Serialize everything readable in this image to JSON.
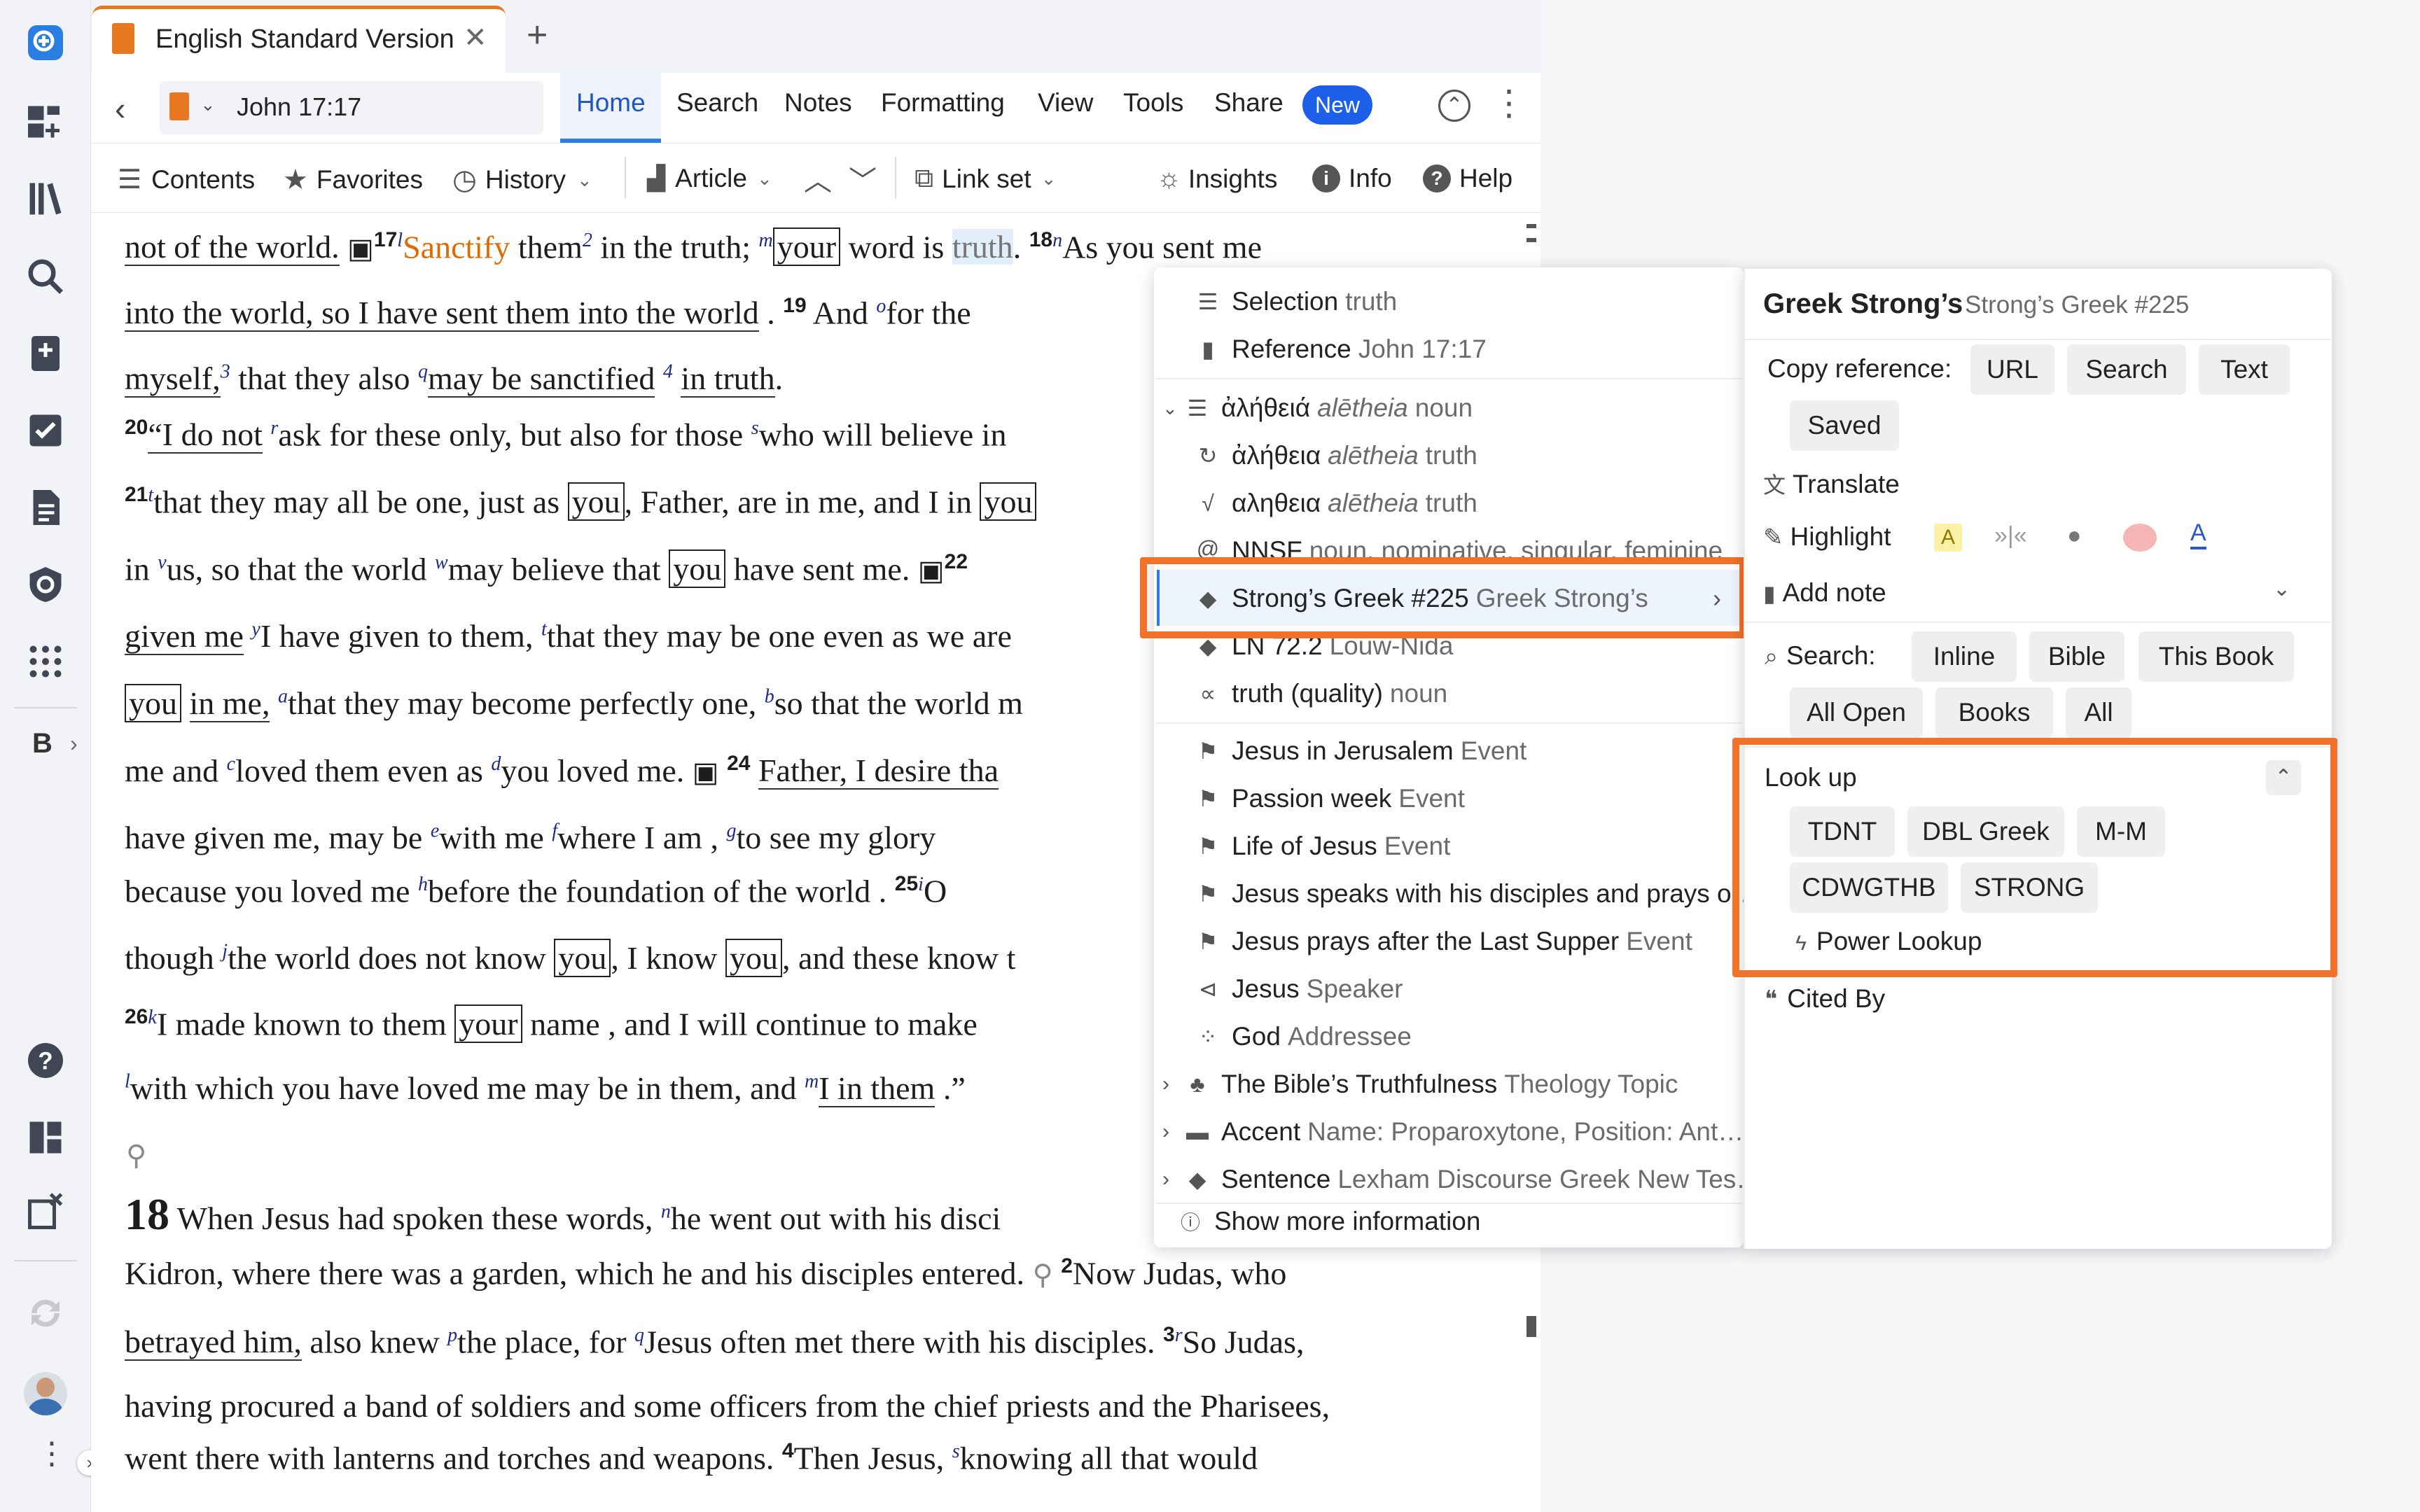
{
  "app": {
    "tab_title": "English Standard Version",
    "add_tab": "+"
  },
  "nav": {
    "reference": "John 17:17",
    "tabs": [
      "Home",
      "Search",
      "Notes",
      "Formatting",
      "View",
      "Tools",
      "Share"
    ],
    "new_badge": "New"
  },
  "toolbar": {
    "contents": "Contents",
    "favorites": "Favorites",
    "history": "History",
    "article": "Article",
    "link_set": "Link set",
    "insights": "Insights",
    "info": "Info",
    "help": "Help"
  },
  "text_lines": [
    "not of the world.",
    "17",
    "Sanctify",
    "them",
    "in the truth;",
    "your",
    "word is",
    "truth",
    "18",
    "As you sent me",
    "into the world, so I have sent them into the world",
    "19",
    "And",
    "for the",
    "myself,",
    "that they also",
    "may be sanctified",
    "in truth",
    "20",
    "“I do not",
    "ask for these only, but also for those",
    "who will believe in",
    "21",
    "that they may all be one, just as",
    "you",
    ", Father, are in me, and I in",
    "in",
    "us, so that the world",
    "may believe that",
    "have sent me.",
    "22",
    "given me",
    "I have given to them,",
    "that they may be one even as we are",
    "in me,",
    "that they may become perfectly one,",
    "so that the world m",
    "me and",
    "loved them even as",
    "you loved me.",
    "24",
    "Father, I desire tha",
    "have given me, may be",
    "with me",
    "where I am",
    "to see my glory",
    "because you loved me",
    "before the foundation of the world",
    "25",
    "O",
    "though",
    "the world does not know",
    ", I know",
    ", and these know t",
    "26",
    "I made known to them",
    "name",
    ", and I will continue to make",
    "with which you have loved me may be in them, and",
    "I in them",
    ".”",
    "18",
    "When Jesus had spoken these words,",
    "he went out with his disci",
    "Kidron, where there was a garden, which he and his disciples entered.",
    "2",
    "Now Judas, who",
    "betrayed him,",
    "also knew",
    "the place, for",
    "Jesus often met there with his disciples.",
    "3",
    "So Judas,",
    "having procured a band of soldiers and some officers from the chief priests and the Pharisees,",
    "went there with lanterns and torches and weapons.",
    "4",
    "Then Jesus,",
    "knowing all that would"
  ],
  "context_menu": {
    "selection_label": "Selection",
    "selection_value": "truth",
    "reference_label": "Reference",
    "reference_value": "John 17:17",
    "items": [
      {
        "main": "ἀλήθειά",
        "sub1": "alētheia",
        "sub2": "noun"
      },
      {
        "main": "ἀλήθεια",
        "sub1": "alētheia",
        "sub2": "truth"
      },
      {
        "main": "αληθεια",
        "sub1": "alētheia",
        "sub2": "truth"
      },
      {
        "main": "NNSF",
        "sub1": "noun, nominative, singular, feminine",
        "sub2": ""
      }
    ],
    "strongs": {
      "main": "Strong’s Greek #225",
      "sub": "Greek Strong’s"
    },
    "ln": {
      "main": "LN 72.2",
      "sub": "Louw-Nida"
    },
    "truth_quality": {
      "main": "truth (quality)",
      "sub": "noun"
    },
    "events": [
      {
        "main": "Jesus in Jerusalem",
        "sub": "Event"
      },
      {
        "main": "Passion week",
        "sub": "Event"
      },
      {
        "main": "Life of Jesus",
        "sub": "Event"
      },
      {
        "main": "Jesus speaks with his disciples and prays o…",
        "sub": ""
      },
      {
        "main": "Jesus prays after the Last Supper",
        "sub": "Event"
      },
      {
        "main": "Jesus",
        "sub": "Speaker"
      },
      {
        "main": "God",
        "sub": "Addressee"
      },
      {
        "main": "The Bible’s Truthfulness",
        "sub": "Theology Topic"
      },
      {
        "main": "Accent",
        "sub": "Name: Proparoxytone, Position: Ant…"
      },
      {
        "main": "Sentence",
        "sub": "Lexham Discourse Greek New Tes…"
      }
    ],
    "show_more": "Show more information"
  },
  "right_panel": {
    "title": "Greek Strong’s",
    "subtitle": "Strong’s Greek #225",
    "copy_reference": "Copy reference:",
    "copy_buttons": [
      "URL",
      "Search",
      "Text",
      "Saved"
    ],
    "translate": "Translate",
    "highlight": "Highlight",
    "add_note": "Add note",
    "search_label": "Search:",
    "search_buttons": [
      "Inline",
      "Bible",
      "This Book",
      "All Open",
      "Books",
      "All"
    ],
    "lookup_title": "Look up",
    "lookup_buttons": [
      "TDNT",
      "DBL Greek",
      "M-M",
      "CDWGTHB",
      "STRONG"
    ],
    "power_lookup": "Power Lookup",
    "cited_by": "Cited By"
  },
  "colors": {
    "accent_orange": "#f0722b",
    "badge_blue": "#1d5fe8",
    "link_blue": "#1d2a86"
  }
}
